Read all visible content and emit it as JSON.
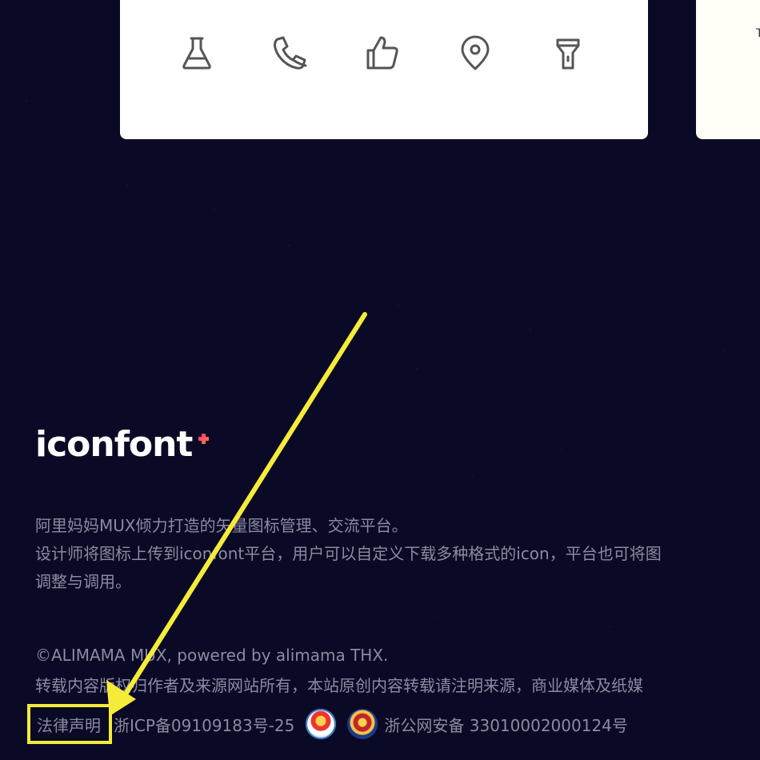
{
  "icon_card": {
    "icons": [
      {
        "name": "flask-icon"
      },
      {
        "name": "phone-icon"
      },
      {
        "name": "thumbs-up-icon"
      },
      {
        "name": "location-pin-icon"
      },
      {
        "name": "flashlight-icon"
      }
    ],
    "icon_color": "#555555"
  },
  "side_card": {
    "glyph": "T"
  },
  "footer": {
    "logo": {
      "text": "iconfont",
      "accent_color": "#ff4f6d"
    },
    "description": [
      "阿里妈妈MUX倾力打造的矢量图标管理、交流平台。",
      "设计师将图标上传到iconfont平台，用户可以自定义下载多种格式的icon，平台也可将图",
      "调整与调用。"
    ],
    "copyright": "©ALIMAMA MUX, powered by alimama THX.",
    "notice": "转载内容版权归作者及来源网站所有，本站原创内容转载请注明来源，商业媒体及纸媒",
    "legal": {
      "legal_link": "法律声明",
      "icp": "浙ICP备09109183号-25",
      "police_record": "浙公网安备 33010002000124号"
    }
  },
  "annotation": {
    "color": "#f5ec3a",
    "target": "法律声明"
  },
  "colors": {
    "background": "#0b0a26",
    "text_muted": "#8a8aa0",
    "card": "#ffffff"
  }
}
